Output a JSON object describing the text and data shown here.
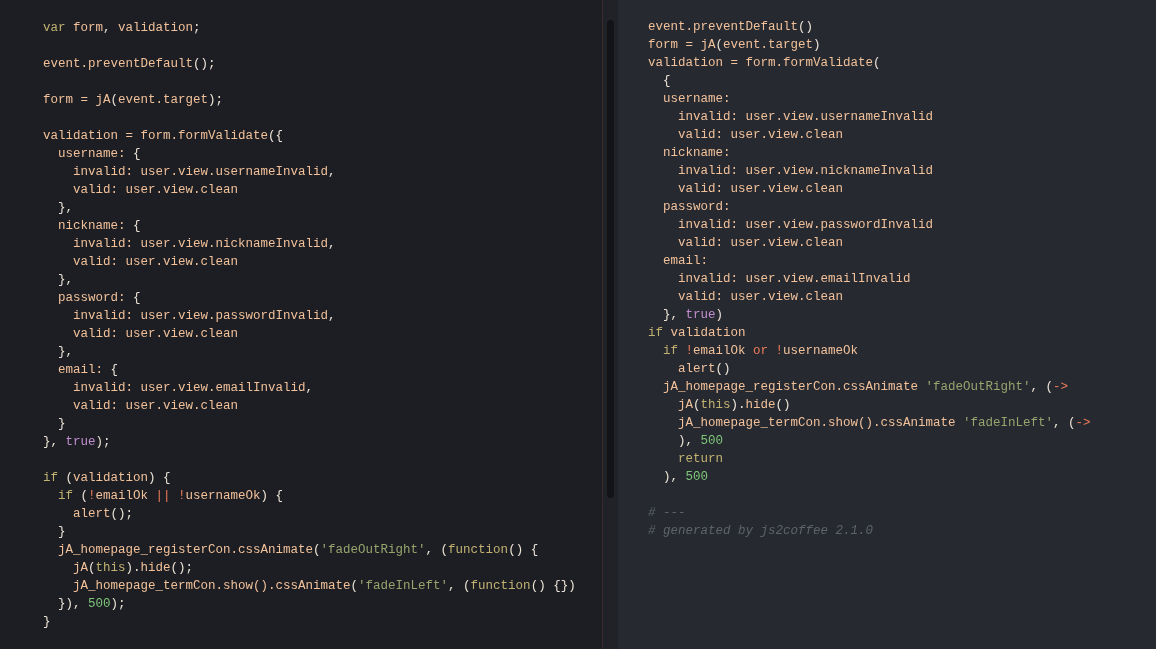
{
  "editors": [
    {
      "lines": [
        {
          "tokens": [
            {
              "kind": "keyword",
              "text": "var"
            },
            {
              "kind": "ident",
              "text": " form"
            },
            {
              "kind": "punct",
              "text": ", "
            },
            {
              "kind": "ident",
              "text": "validation"
            },
            {
              "kind": "punct",
              "text": ";"
            }
          ]
        },
        {
          "kind": "blank"
        },
        {
          "tokens": [
            {
              "kind": "ident",
              "text": "event.preventDefault"
            },
            {
              "kind": "punct",
              "text": "();"
            }
          ]
        },
        {
          "kind": "blank"
        },
        {
          "tokens": [
            {
              "kind": "ident",
              "text": "form = jA"
            },
            {
              "kind": "punct",
              "text": "("
            },
            {
              "kind": "ident",
              "text": "event.target"
            },
            {
              "kind": "punct",
              "text": ");"
            }
          ]
        },
        {
          "kind": "blank"
        },
        {
          "tokens": [
            {
              "kind": "ident",
              "text": "validation = form.formValidate"
            },
            {
              "kind": "punct",
              "text": "({"
            }
          ]
        },
        {
          "tokens": [
            {
              "kind": "ident",
              "text": "  username: "
            },
            {
              "kind": "punct",
              "text": "{"
            }
          ]
        },
        {
          "tokens": [
            {
              "kind": "ident",
              "text": "    invalid: user.view.usernameInvalid"
            },
            {
              "kind": "punct",
              "text": ","
            }
          ]
        },
        {
          "tokens": [
            {
              "kind": "ident",
              "text": "    valid: user.view.clean"
            }
          ]
        },
        {
          "tokens": [
            {
              "kind": "punct",
              "text": "  },"
            }
          ]
        },
        {
          "tokens": [
            {
              "kind": "ident",
              "text": "  nickname: "
            },
            {
              "kind": "punct",
              "text": "{"
            }
          ]
        },
        {
          "tokens": [
            {
              "kind": "ident",
              "text": "    invalid: user.view.nicknameInvalid"
            },
            {
              "kind": "punct",
              "text": ","
            }
          ]
        },
        {
          "tokens": [
            {
              "kind": "ident",
              "text": "    valid: user.view.clean"
            }
          ]
        },
        {
          "tokens": [
            {
              "kind": "punct",
              "text": "  },"
            }
          ]
        },
        {
          "tokens": [
            {
              "kind": "ident",
              "text": "  password: "
            },
            {
              "kind": "punct",
              "text": "{"
            }
          ]
        },
        {
          "tokens": [
            {
              "kind": "ident",
              "text": "    invalid: user.view.passwordInvalid"
            },
            {
              "kind": "punct",
              "text": ","
            }
          ]
        },
        {
          "tokens": [
            {
              "kind": "ident",
              "text": "    valid: user.view.clean"
            }
          ]
        },
        {
          "tokens": [
            {
              "kind": "punct",
              "text": "  },"
            }
          ]
        },
        {
          "tokens": [
            {
              "kind": "ident",
              "text": "  email: "
            },
            {
              "kind": "punct",
              "text": "{"
            }
          ]
        },
        {
          "tokens": [
            {
              "kind": "ident",
              "text": "    invalid: user.view.emailInvalid"
            },
            {
              "kind": "punct",
              "text": ","
            }
          ]
        },
        {
          "tokens": [
            {
              "kind": "ident",
              "text": "    valid: user.view.clean"
            }
          ]
        },
        {
          "tokens": [
            {
              "kind": "punct",
              "text": "  }"
            }
          ]
        },
        {
          "tokens": [
            {
              "kind": "punct",
              "text": "}, "
            },
            {
              "kind": "boolean",
              "text": "true"
            },
            {
              "kind": "punct",
              "text": ");"
            }
          ]
        },
        {
          "kind": "blank"
        },
        {
          "tokens": [
            {
              "kind": "keyword",
              "text": "if"
            },
            {
              "kind": "punct",
              "text": " ("
            },
            {
              "kind": "ident",
              "text": "validation"
            },
            {
              "kind": "punct",
              "text": ") {"
            }
          ]
        },
        {
          "tokens": [
            {
              "kind": "keyword",
              "text": "  if"
            },
            {
              "kind": "punct",
              "text": " ("
            },
            {
              "kind": "operator",
              "text": "!"
            },
            {
              "kind": "ident",
              "text": "emailOk "
            },
            {
              "kind": "operator",
              "text": "|| !"
            },
            {
              "kind": "ident",
              "text": "usernameOk"
            },
            {
              "kind": "punct",
              "text": ") {"
            }
          ]
        },
        {
          "tokens": [
            {
              "kind": "ident",
              "text": "    alert"
            },
            {
              "kind": "punct",
              "text": "();"
            }
          ]
        },
        {
          "tokens": [
            {
              "kind": "punct",
              "text": "  }"
            }
          ]
        },
        {
          "tokens": [
            {
              "kind": "ident",
              "text": "  jA_homepage_registerCon.cssAnimate"
            },
            {
              "kind": "punct",
              "text": "("
            },
            {
              "kind": "string",
              "text": "'fadeOutRight'"
            },
            {
              "kind": "punct",
              "text": ", ("
            },
            {
              "kind": "keyword",
              "text": "function"
            },
            {
              "kind": "punct",
              "text": "() {"
            }
          ]
        },
        {
          "tokens": [
            {
              "kind": "ident",
              "text": "    jA"
            },
            {
              "kind": "punct",
              "text": "("
            },
            {
              "kind": "keyword",
              "text": "this"
            },
            {
              "kind": "punct",
              "text": ")."
            },
            {
              "kind": "ident",
              "text": "hide"
            },
            {
              "kind": "punct",
              "text": "();"
            }
          ]
        },
        {
          "tokens": [
            {
              "kind": "ident",
              "text": "    jA_homepage_termCon.show().cssAnimate"
            },
            {
              "kind": "punct",
              "text": "("
            },
            {
              "kind": "string",
              "text": "'fadeInLeft'"
            },
            {
              "kind": "punct",
              "text": ", ("
            },
            {
              "kind": "keyword",
              "text": "function"
            },
            {
              "kind": "punct",
              "text": "() {})"
            }
          ]
        },
        {
          "tokens": [
            {
              "kind": "punct",
              "text": "  }), "
            },
            {
              "kind": "number",
              "text": "500"
            },
            {
              "kind": "punct",
              "text": ");"
            }
          ]
        },
        {
          "tokens": [
            {
              "kind": "punct",
              "text": "}"
            }
          ]
        }
      ]
    },
    {
      "lines": [
        {
          "tokens": [
            {
              "kind": "ident",
              "text": "event.preventDefault"
            },
            {
              "kind": "punct",
              "text": "()"
            }
          ]
        },
        {
          "tokens": [
            {
              "kind": "ident",
              "text": "form = jA"
            },
            {
              "kind": "punct",
              "text": "("
            },
            {
              "kind": "ident",
              "text": "event.target"
            },
            {
              "kind": "punct",
              "text": ")"
            }
          ]
        },
        {
          "tokens": [
            {
              "kind": "ident",
              "text": "validation = form.formValidate"
            },
            {
              "kind": "punct",
              "text": "("
            }
          ]
        },
        {
          "tokens": [
            {
              "kind": "punct",
              "text": "  {"
            }
          ]
        },
        {
          "tokens": [
            {
              "kind": "ident",
              "text": "  username:"
            }
          ]
        },
        {
          "tokens": [
            {
              "kind": "ident",
              "text": "    invalid: user.view.usernameInvalid"
            }
          ]
        },
        {
          "tokens": [
            {
              "kind": "ident",
              "text": "    valid: user.view.clean"
            }
          ]
        },
        {
          "tokens": [
            {
              "kind": "ident",
              "text": "  nickname:"
            }
          ]
        },
        {
          "tokens": [
            {
              "kind": "ident",
              "text": "    invalid: user.view.nicknameInvalid"
            }
          ]
        },
        {
          "tokens": [
            {
              "kind": "ident",
              "text": "    valid: user.view.clean"
            }
          ]
        },
        {
          "tokens": [
            {
              "kind": "ident",
              "text": "  password:"
            }
          ]
        },
        {
          "tokens": [
            {
              "kind": "ident",
              "text": "    invalid: user.view.passwordInvalid"
            }
          ]
        },
        {
          "tokens": [
            {
              "kind": "ident",
              "text": "    valid: user.view.clean"
            }
          ]
        },
        {
          "tokens": [
            {
              "kind": "ident",
              "text": "  email:"
            }
          ]
        },
        {
          "tokens": [
            {
              "kind": "ident",
              "text": "    invalid: user.view.emailInvalid"
            }
          ]
        },
        {
          "tokens": [
            {
              "kind": "ident",
              "text": "    valid: user.view.clean"
            }
          ]
        },
        {
          "tokens": [
            {
              "kind": "punct",
              "text": "  }, "
            },
            {
              "kind": "boolean",
              "text": "true"
            },
            {
              "kind": "punct",
              "text": ")"
            }
          ]
        },
        {
          "tokens": [
            {
              "kind": "keyword",
              "text": "if"
            },
            {
              "kind": "ident",
              "text": " validation"
            }
          ]
        },
        {
          "tokens": [
            {
              "kind": "keyword",
              "text": "  if"
            },
            {
              "kind": "operator",
              "text": " !"
            },
            {
              "kind": "ident",
              "text": "emailOk "
            },
            {
              "kind": "operator",
              "text": "or !"
            },
            {
              "kind": "ident",
              "text": "usernameOk"
            }
          ]
        },
        {
          "tokens": [
            {
              "kind": "ident",
              "text": "    alert"
            },
            {
              "kind": "punct",
              "text": "()"
            }
          ]
        },
        {
          "tokens": [
            {
              "kind": "ident",
              "text": "  jA_homepage_registerCon.cssAnimate "
            },
            {
              "kind": "string",
              "text": "'fadeOutRight'"
            },
            {
              "kind": "punct",
              "text": ", ("
            },
            {
              "kind": "operator",
              "text": "->"
            }
          ]
        },
        {
          "tokens": [
            {
              "kind": "ident",
              "text": "    jA"
            },
            {
              "kind": "punct",
              "text": "("
            },
            {
              "kind": "keyword",
              "text": "this"
            },
            {
              "kind": "punct",
              "text": ")."
            },
            {
              "kind": "ident",
              "text": "hide"
            },
            {
              "kind": "punct",
              "text": "()"
            }
          ]
        },
        {
          "tokens": [
            {
              "kind": "ident",
              "text": "    jA_homepage_termCon.show().cssAnimate "
            },
            {
              "kind": "string",
              "text": "'fadeInLeft'"
            },
            {
              "kind": "punct",
              "text": ", ("
            },
            {
              "kind": "operator",
              "text": "->"
            }
          ]
        },
        {
          "tokens": [
            {
              "kind": "punct",
              "text": "    ), "
            },
            {
              "kind": "number",
              "text": "500"
            }
          ]
        },
        {
          "tokens": [
            {
              "kind": "keyword",
              "text": "    return"
            }
          ]
        },
        {
          "tokens": [
            {
              "kind": "punct",
              "text": "  ), "
            },
            {
              "kind": "number",
              "text": "500"
            }
          ]
        },
        {
          "kind": "blank"
        },
        {
          "tokens": [
            {
              "kind": "comment",
              "text": "# ---"
            }
          ]
        },
        {
          "tokens": [
            {
              "kind": "comment",
              "text": "# generated by js2coffee 2.1.0"
            }
          ]
        }
      ]
    }
  ]
}
